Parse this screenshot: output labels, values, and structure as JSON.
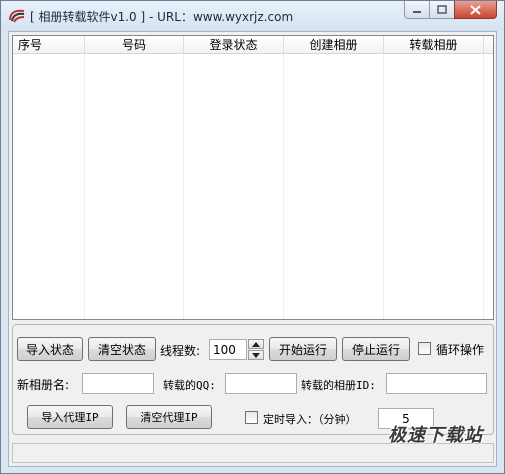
{
  "window": {
    "title": "[ 相册转载软件v1.0 ] - URL：www.wyxrjz.com",
    "minimize_icon": "minimize-icon",
    "maximize_icon": "maximize-icon",
    "close_icon": "close-icon"
  },
  "list": {
    "columns": [
      "序号",
      "号码",
      "登录状态",
      "创建相册",
      "转载相册"
    ],
    "rows": []
  },
  "controls": {
    "import_status_label": "导入状态",
    "clear_status_label": "清空状态",
    "threads_label": "线程数:",
    "threads_value": "100",
    "start_label": "开始运行",
    "stop_label": "停止运行",
    "loop_label": "循环操作",
    "loop_checked": false,
    "new_album_label": "新相册名:",
    "new_album_value": "",
    "repost_qq_label": "转载的QQ:",
    "repost_qq_value": "",
    "repost_album_id_label": "转载的相册ID:",
    "repost_album_id_value": "",
    "import_proxy_label": "导入代理IP",
    "clear_proxy_label": "清空代理IP",
    "timed_import_label": "定时导入：（分钟）",
    "timed_import_checked": false,
    "timed_import_value": "5"
  },
  "watermark": "极速下载站"
}
